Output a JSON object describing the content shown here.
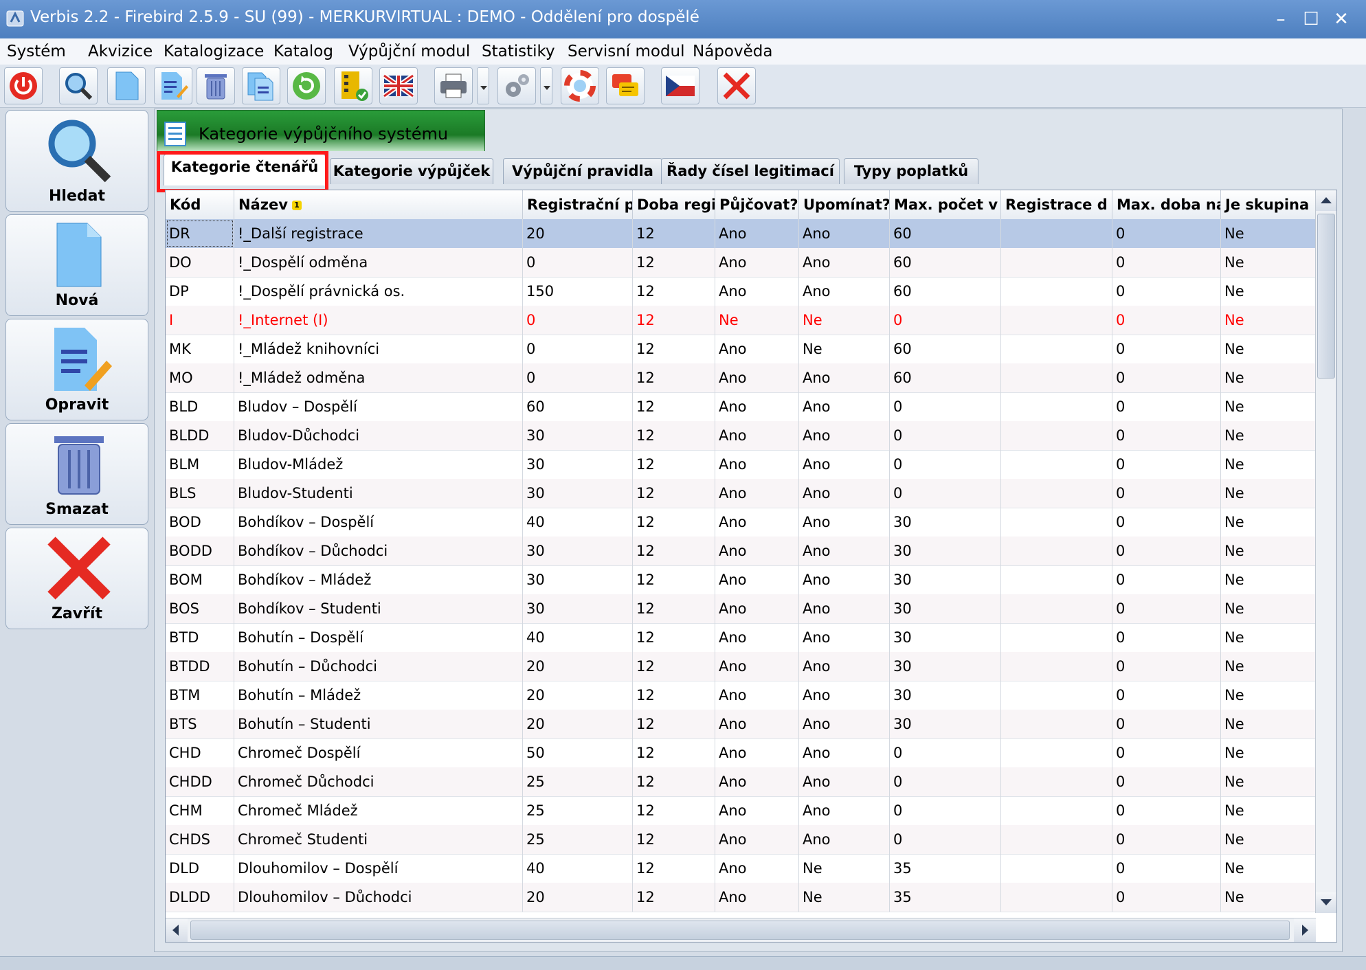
{
  "window": {
    "title": "Verbis 2.2 - Firebird 2.5.9 - SU (99) - MERKURVIRTUAL : DEMO - Oddělení pro dospělé",
    "controls": {
      "minimize": "–",
      "maximize": "☐",
      "close": "✕"
    }
  },
  "menu": [
    "Systém",
    "Akvizice",
    "Katalogizace",
    "Katalog",
    "Výpůjční modul",
    "Statistiky",
    "Servisní modul",
    "Nápověda"
  ],
  "toolbar_icons": [
    "power-icon",
    "search-icon",
    "new-document-icon",
    "edit-document-icon",
    "trash-icon",
    "copy-document-icon",
    "refresh-icon",
    "checklist-icon",
    "uk-flag-icon",
    "printer-icon",
    "gears-icon",
    "lifebuoy-icon",
    "chat-icon",
    "czech-flag-icon",
    "close-icon"
  ],
  "left_panel": {
    "search": "Hledat",
    "new": "Nová",
    "edit": "Opravit",
    "delete": "Smazat",
    "close": "Zavřít"
  },
  "main_tab": "Kategorie výpůjčního systému",
  "sub_tabs": [
    "Kategorie čtenářů",
    "Kategorie výpůjček",
    "Výpůjční pravidla",
    "Řady čísel legitimací",
    "Typy poplatků"
  ],
  "sort_indicator": "1",
  "columns": [
    "Kód",
    "Název",
    "Registrační p",
    "Doba regi",
    "Půjčovat?",
    "Upomínat?",
    "Max. počet v",
    "Registrace d",
    "Max. doba na",
    "Je skupina"
  ],
  "rows": [
    [
      "DR",
      "!_Další registrace",
      "20",
      "12",
      "Ano",
      "Ano",
      "60",
      "",
      "0",
      "Ne"
    ],
    [
      "DO",
      "!_Dospělí odměna",
      "0",
      "12",
      "Ano",
      "Ano",
      "60",
      "",
      "0",
      "Ne"
    ],
    [
      "DP",
      "!_Dospělí právnická os.",
      "150",
      "12",
      "Ano",
      "Ano",
      "60",
      "",
      "0",
      "Ne"
    ],
    [
      "I",
      "!_Internet  (I)",
      "0",
      "12",
      "Ne",
      "Ne",
      "0",
      "",
      "0",
      "Ne"
    ],
    [
      "MK",
      "!_Mládež knihovníci",
      "0",
      "12",
      "Ano",
      "Ne",
      "60",
      "",
      "0",
      "Ne"
    ],
    [
      "MO",
      "!_Mládež odměna",
      "0",
      "12",
      "Ano",
      "Ano",
      "60",
      "",
      "0",
      "Ne"
    ],
    [
      "BLD",
      "Bludov – Dospělí",
      "60",
      "12",
      "Ano",
      "Ano",
      "0",
      "",
      "0",
      "Ne"
    ],
    [
      "BLDD",
      "Bludov-Důchodci",
      "30",
      "12",
      "Ano",
      "Ano",
      "0",
      "",
      "0",
      "Ne"
    ],
    [
      "BLM",
      "Bludov-Mládež",
      "30",
      "12",
      "Ano",
      "Ano",
      "0",
      "",
      "0",
      "Ne"
    ],
    [
      "BLS",
      "Bludov-Studenti",
      "30",
      "12",
      "Ano",
      "Ano",
      "0",
      "",
      "0",
      "Ne"
    ],
    [
      "BOD",
      "Bohdíkov – Dospělí",
      "40",
      "12",
      "Ano",
      "Ano",
      "30",
      "",
      "0",
      "Ne"
    ],
    [
      "BODD",
      "Bohdíkov – Důchodci",
      "30",
      "12",
      "Ano",
      "Ano",
      "30",
      "",
      "0",
      "Ne"
    ],
    [
      "BOM",
      "Bohdíkov – Mládež",
      "30",
      "12",
      "Ano",
      "Ano",
      "30",
      "",
      "0",
      "Ne"
    ],
    [
      "BOS",
      "Bohdíkov – Studenti",
      "30",
      "12",
      "Ano",
      "Ano",
      "30",
      "",
      "0",
      "Ne"
    ],
    [
      "BTD",
      "Bohutín – Dospělí",
      "40",
      "12",
      "Ano",
      "Ano",
      "30",
      "",
      "0",
      "Ne"
    ],
    [
      "BTDD",
      "Bohutín – Důchodci",
      "20",
      "12",
      "Ano",
      "Ano",
      "30",
      "",
      "0",
      "Ne"
    ],
    [
      "BTM",
      "Bohutín – Mládež",
      "20",
      "12",
      "Ano",
      "Ano",
      "30",
      "",
      "0",
      "Ne"
    ],
    [
      "BTS",
      "Bohutín – Studenti",
      "20",
      "12",
      "Ano",
      "Ano",
      "30",
      "",
      "0",
      "Ne"
    ],
    [
      "CHD",
      "Chromeč Dospělí",
      "50",
      "12",
      "Ano",
      "Ano",
      "0",
      "",
      "0",
      "Ne"
    ],
    [
      "CHDD",
      "Chromeč Důchodci",
      "25",
      "12",
      "Ano",
      "Ano",
      "0",
      "",
      "0",
      "Ne"
    ],
    [
      "CHM",
      "Chromeč Mládež",
      "25",
      "12",
      "Ano",
      "Ano",
      "0",
      "",
      "0",
      "Ne"
    ],
    [
      "CHDS",
      "Chromeč Studenti",
      "25",
      "12",
      "Ano",
      "Ano",
      "0",
      "",
      "0",
      "Ne"
    ],
    [
      "DLD",
      "Dlouhomilov – Dospělí",
      "40",
      "12",
      "Ano",
      "Ne",
      "35",
      "",
      "0",
      "Ne"
    ],
    [
      "DLDD",
      "Dlouhomilov – Důchodci",
      "20",
      "12",
      "Ano",
      "Ne",
      "35",
      "",
      "0",
      "Ne"
    ]
  ],
  "highlight_row_color": "#ff0000",
  "selected_row_color": "#b7c9e6"
}
